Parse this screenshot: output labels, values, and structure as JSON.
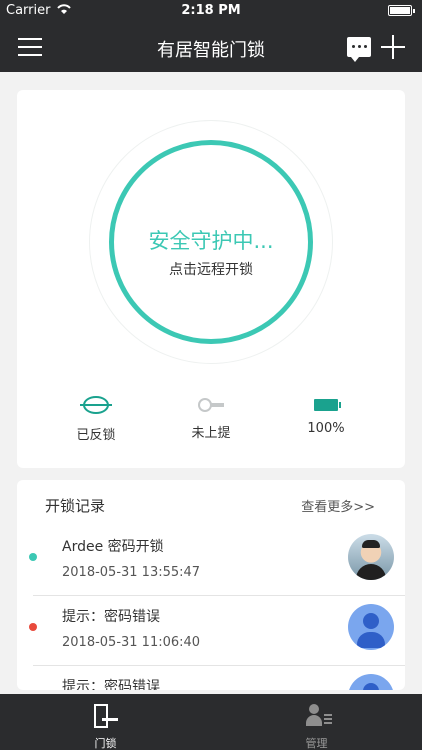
{
  "status_bar": {
    "carrier": "Carrier",
    "time": "2:18 PM"
  },
  "header": {
    "title": "有居智能门锁"
  },
  "guard": {
    "status": "安全守护中...",
    "action": "点击远程开锁"
  },
  "lock_status": [
    {
      "label": "已反锁",
      "icon": "deadbolt-locked-icon"
    },
    {
      "label": "未上提",
      "icon": "key-handle-icon"
    },
    {
      "label": "100%",
      "icon": "battery-icon"
    }
  ],
  "records": {
    "title": "开锁记录",
    "more": "查看更多>>",
    "items": [
      {
        "title": "Ardee  密码开锁",
        "time": "2018-05-31 13:55:47",
        "dot_color": "#3cc8b4",
        "avatar": "photo"
      },
      {
        "title": "提示：密码错误",
        "time": "2018-05-31 11:06:40",
        "dot_color": "#e84a3c",
        "avatar": "default"
      },
      {
        "title": "提示：密码错误",
        "time": "",
        "dot_color": "#e84a3c",
        "avatar": "default"
      }
    ]
  },
  "tabs": [
    {
      "label": "门锁",
      "icon": "door-lock-icon",
      "active": true
    },
    {
      "label": "管理",
      "icon": "user-manage-icon",
      "active": false
    }
  ],
  "colors": {
    "accent": "#3cc8b4",
    "bar": "#2b2c2e",
    "alert": "#e84a3c"
  }
}
